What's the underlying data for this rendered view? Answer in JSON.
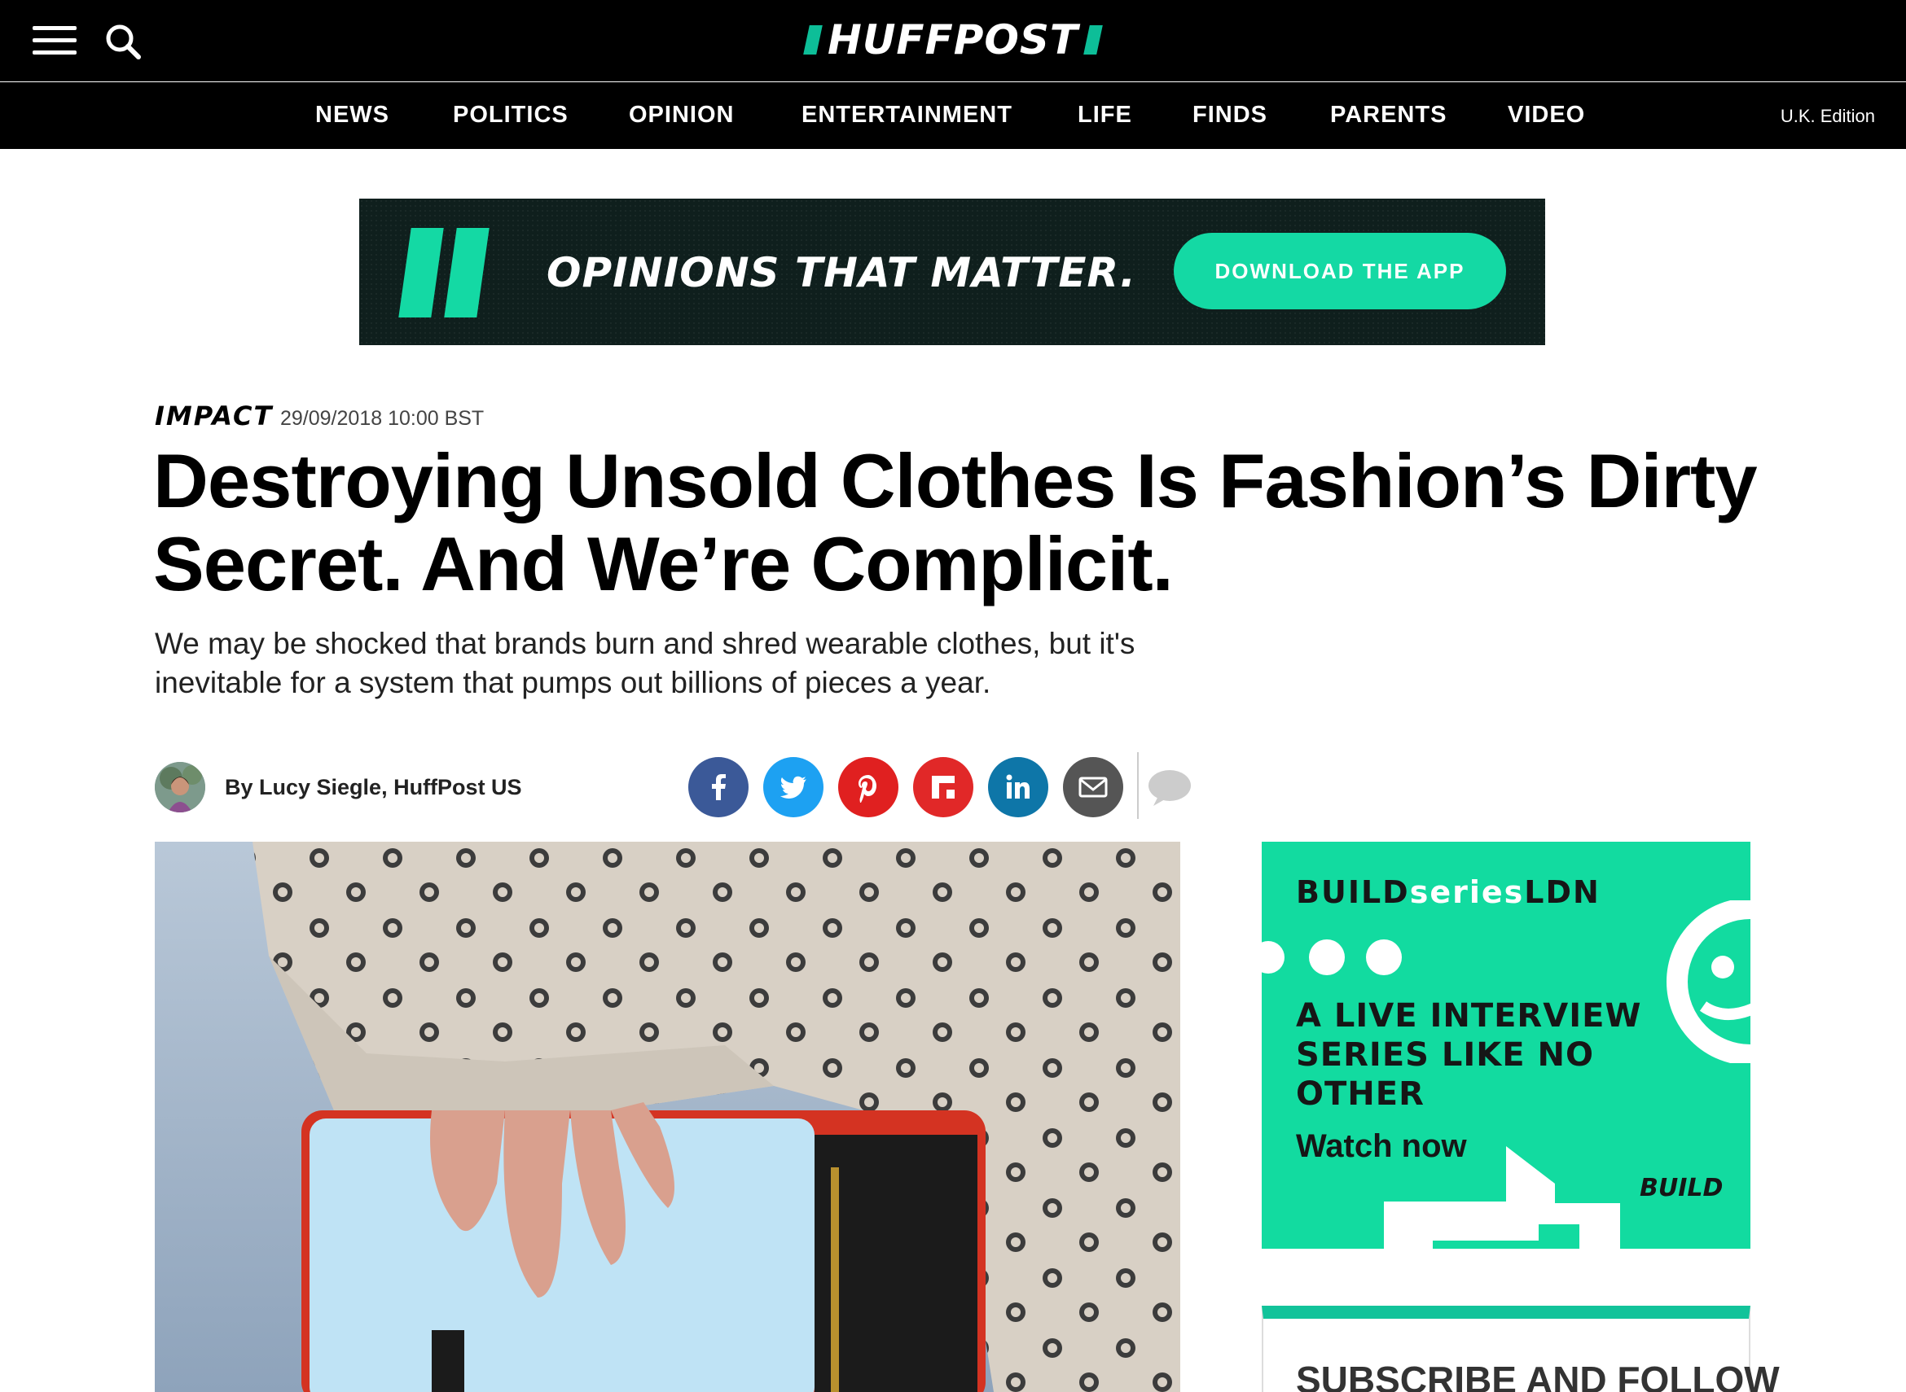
{
  "header": {
    "logo_text": "HUFFPOST",
    "menu_icon": "hamburger-menu-icon",
    "search_icon": "search-icon"
  },
  "nav": {
    "items": [
      "NEWS",
      "POLITICS",
      "OPINION",
      "ENTERTAINMENT",
      "LIFE",
      "FINDS",
      "PARENTS",
      "VIDEO"
    ],
    "edition": "U.K. Edition"
  },
  "banner_ad": {
    "title": "OPINIONS THAT MATTER.",
    "button": "DOWNLOAD THE APP"
  },
  "article": {
    "kicker": "IMPACT",
    "timestamp": "29/09/2018 10:00 BST",
    "headline": "Destroying Unsold Clothes Is Fashion’s Dirty Secret. And We’re Complicit.",
    "dek": "We may be shocked that brands burn and shred wearable clothes, but it's inevitable for a system that pumps out billions of pieces a year.",
    "byline": "By Lucy Siegle, HuffPost US"
  },
  "share": {
    "icons": [
      "facebook-icon",
      "twitter-icon",
      "pinterest-icon",
      "flipboard-icon",
      "linkedin-icon",
      "email-icon",
      "comments-icon"
    ]
  },
  "sidebar_ad": {
    "brand_part1": "BUILD",
    "brand_part2": "series",
    "brand_part3": "LDN",
    "tagline": "A LIVE INTERVIEW SERIES LIKE NO OTHER",
    "cta": "Watch now",
    "badge": "BUILD"
  },
  "subscribe": {
    "title": "SUBSCRIBE AND FOLLOW"
  },
  "colors": {
    "brand_green": "#0dbe98",
    "ad_green": "#12dba0",
    "facebook": "#3b5998",
    "twitter": "#1da1f2",
    "pinterest": "#e02020",
    "flipboard": "#e12828",
    "linkedin": "#0e76a8",
    "email": "#555555"
  }
}
